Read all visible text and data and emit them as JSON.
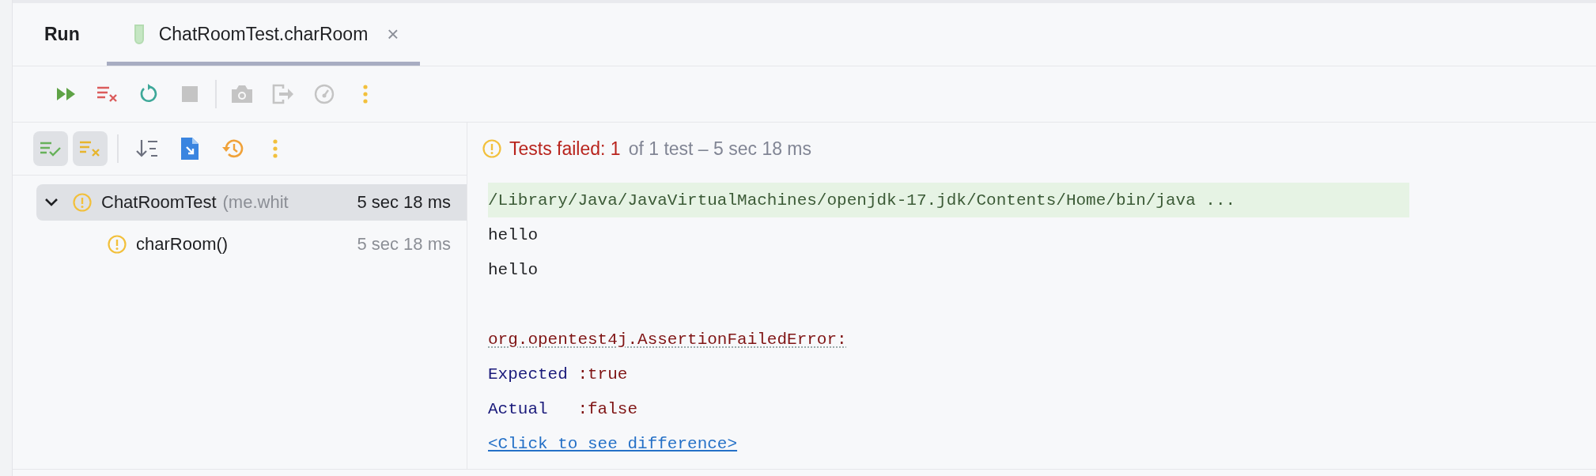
{
  "tool_window": {
    "title": "Run"
  },
  "tabs": [
    {
      "label": "ChatRoomTest.charRoom",
      "close": "×",
      "selected": true
    }
  ],
  "toolbar": [
    {
      "kind": "rerun",
      "disabled": false
    },
    {
      "kind": "rerun-failed",
      "disabled": false
    },
    {
      "kind": "toggle-auto",
      "disabled": false
    },
    {
      "kind": "stop",
      "disabled": true
    },
    {
      "kind": "separator"
    },
    {
      "kind": "screenshot",
      "disabled": true
    },
    {
      "kind": "exit",
      "disabled": true
    },
    {
      "kind": "profiler",
      "disabled": true
    },
    {
      "kind": "more",
      "disabled": false
    }
  ],
  "test_toolbar": [
    {
      "kind": "show-passed",
      "selected": true
    },
    {
      "kind": "show-ignored",
      "selected": true
    },
    {
      "kind": "separator"
    },
    {
      "kind": "sort"
    },
    {
      "kind": "import"
    },
    {
      "kind": "history"
    },
    {
      "kind": "more"
    }
  ],
  "tree": [
    {
      "name": "ChatRoomTest",
      "detail": "(me.whit",
      "duration": "5 sec 18 ms",
      "kind": "failed",
      "expanded": true,
      "selected": true,
      "children": [
        {
          "name": "charRoom()",
          "duration": "5 sec 18 ms",
          "kind": "failed",
          "selected": false
        }
      ]
    }
  ],
  "summary": {
    "kind": "failed",
    "failed_text": "Tests failed: 1",
    "detail": "of 1 test – 5 sec 18 ms"
  },
  "console": [
    {
      "kind": "command",
      "text": "/Library/Java/JavaVirtualMachines/openjdk-17.jdk/Contents/Home/bin/java ..."
    },
    {
      "kind": "stdout",
      "text": "hello"
    },
    {
      "kind": "stdout",
      "text": "hello"
    },
    {
      "kind": "blank"
    },
    {
      "kind": "error",
      "text": "org.opentest4j.AssertionFailedError:"
    },
    {
      "kind": "compare",
      "label": "Expected",
      "value": ":true"
    },
    {
      "kind": "compare",
      "label": "Actual",
      "value": ":false"
    },
    {
      "kind": "link",
      "text": "<Click to see difference>"
    }
  ]
}
